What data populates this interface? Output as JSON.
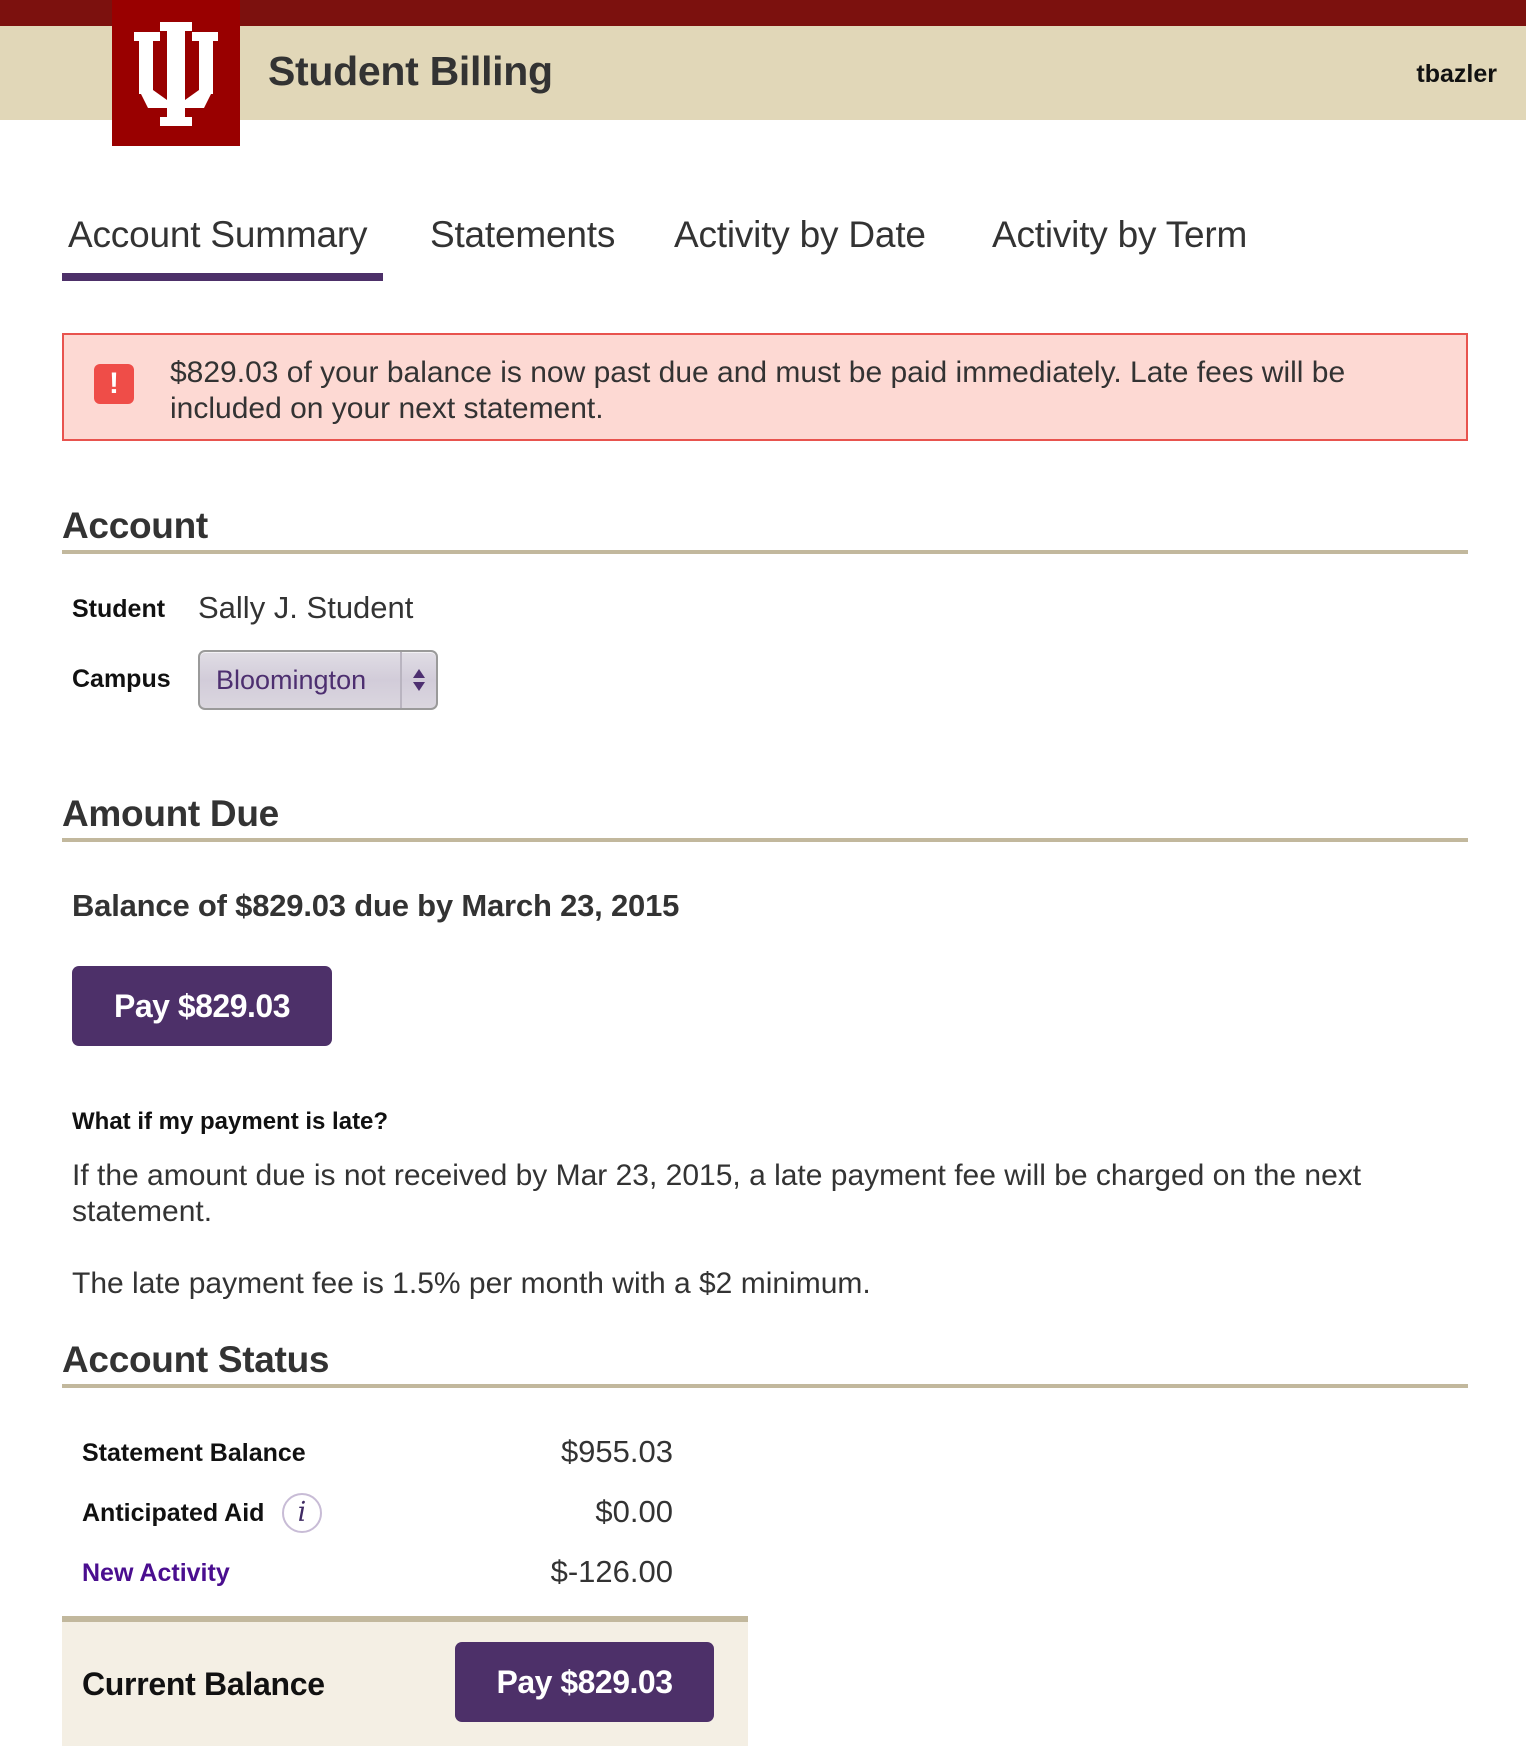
{
  "header": {
    "logo_icon": "iu-trident-icon",
    "title": "Student Billing",
    "username": "tbazler"
  },
  "tabs": [
    {
      "label": "Account Summary",
      "active": true
    },
    {
      "label": "Statements",
      "active": false
    },
    {
      "label": "Activity by Date",
      "active": false
    },
    {
      "label": "Activity by Term",
      "active": false
    }
  ],
  "alert": {
    "icon": "exclamation-icon",
    "icon_glyph": "!",
    "message": "$829.03 of your balance is now past due and must be paid immediately. Late fees will be included on your next statement."
  },
  "account": {
    "heading": "Account",
    "student_label": "Student",
    "student_value": "Sally J. Student",
    "campus_label": "Campus",
    "campus_selected": "Bloomington"
  },
  "amount_due": {
    "heading": "Amount Due",
    "balance_text": "Balance of $829.03 due by March 23, 2015",
    "pay_button": "Pay $829.03",
    "late_question": "What if my payment is late?",
    "late_paragraph": "If the amount due is not received by Mar 23, 2015, a late payment fee will be charged on the next statement.",
    "fee_paragraph": "The late payment fee is 1.5% per month with a $2 minimum."
  },
  "account_status": {
    "heading": "Account Status",
    "rows": [
      {
        "label": "Statement Balance",
        "value": "$955.03"
      },
      {
        "label": "Anticipated Aid",
        "value": "$0.00",
        "info_icon": "info-icon",
        "info_glyph": "i"
      },
      {
        "label": "New Activity",
        "value": "$-126.00"
      }
    ],
    "current_balance_label": "Current Balance",
    "pay_button": "Pay $829.03"
  },
  "colors": {
    "crimson": "#990000",
    "top_bar": "#7c110e",
    "cream": "#e1d7b8",
    "purple": "#4d3069",
    "alert_bg": "#fdd9d3",
    "alert_border": "#e8534e",
    "link": "#4a0e8f"
  }
}
